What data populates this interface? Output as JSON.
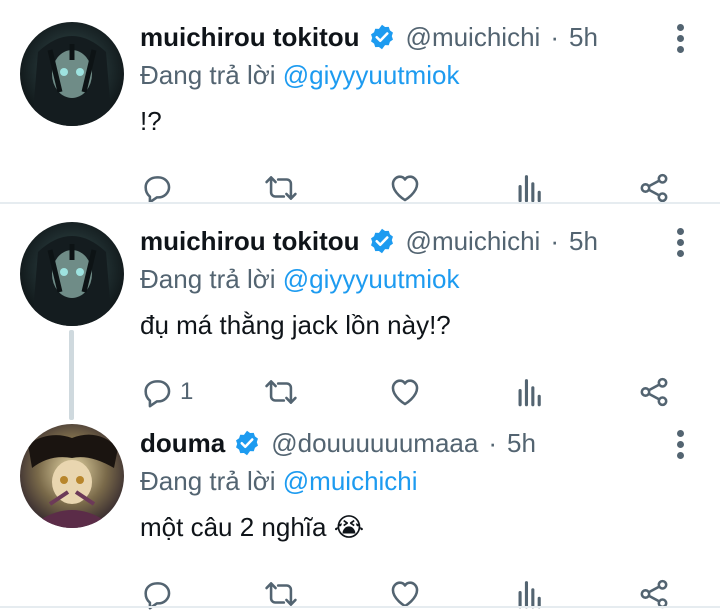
{
  "tweets": [
    {
      "name": "muichirou tokitou",
      "handle": "@muichichi",
      "separator": "·",
      "time": "5h",
      "reply_prefix": "Đang trả lời ",
      "reply_to": "@giyyyuutmiok",
      "text": "!?",
      "reply_count": ""
    },
    {
      "name": "muichirou tokitou",
      "handle": "@muichichi",
      "separator": "·",
      "time": "5h",
      "reply_prefix": "Đang trả lời ",
      "reply_to": "@giyyyuutmiok",
      "text": "đụ má thằng jack lồn này!?",
      "reply_count": "1"
    },
    {
      "name": "douma",
      "handle": "@douuuuuumaaa",
      "separator": "·",
      "time": "5h",
      "reply_prefix": "Đang trả lời ",
      "reply_to": "@muichichi",
      "text": "một câu 2 nghĩa ",
      "emoji": "😭",
      "reply_count": ""
    }
  ],
  "colors": {
    "accent": "#1d9bf0",
    "muted": "#536471",
    "text": "#0f1419",
    "divider": "#e6ecf0"
  },
  "icons": [
    "reply-icon",
    "retweet-icon",
    "like-icon",
    "analytics-icon",
    "share-icon",
    "more-icon",
    "verified-icon"
  ]
}
